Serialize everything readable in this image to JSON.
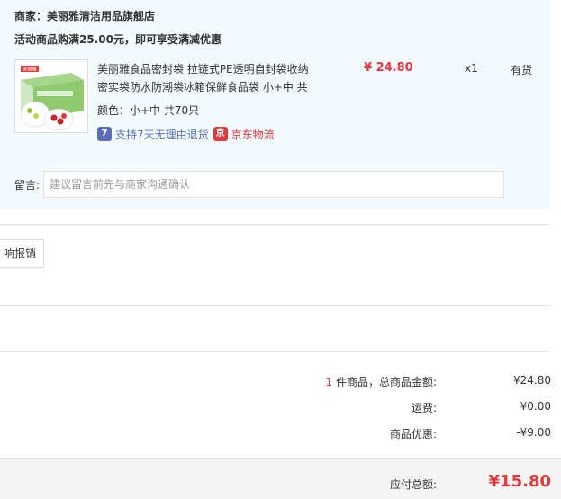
{
  "store": {
    "merchant": "商家：美丽雅清洁用品旗舰店",
    "promo": "活动商品购满25.00元，即可享受满减优惠"
  },
  "product": {
    "title_line1": "美丽雅食品密封袋 拉链式PE透明自封袋收纳",
    "title_line2": "密实袋防水防潮袋冰箱保鲜食品袋 小+中 共",
    "price": "¥ 24.80",
    "qty": "x1",
    "stock": "有货",
    "variant": "颜色：小+中 共70只",
    "thumb_brand": "美丽雅"
  },
  "services": {
    "return_icon": "7",
    "return_text": "支持7天无理由退货",
    "jd_icon": "京",
    "jd_text": "京东物流"
  },
  "remark": {
    "label": "留言:",
    "placeholder": "建议留言前先与商家沟通确认"
  },
  "invoice": {
    "button_label": "响报销"
  },
  "summary": {
    "count": "1",
    "items_label": " 件商品，总商品金额:",
    "items_value": "¥24.80",
    "shipping_label": "运费:",
    "shipping_value": "¥0.00",
    "discount_label": "商品优惠:",
    "discount_value": "-¥9.00",
    "total_label": "应付总额:",
    "total_value": "¥15.80"
  },
  "colors": {
    "accent_red": "#e4393c",
    "panel_bg": "#f3fbfe",
    "service_blue": "#5a6fb5"
  }
}
